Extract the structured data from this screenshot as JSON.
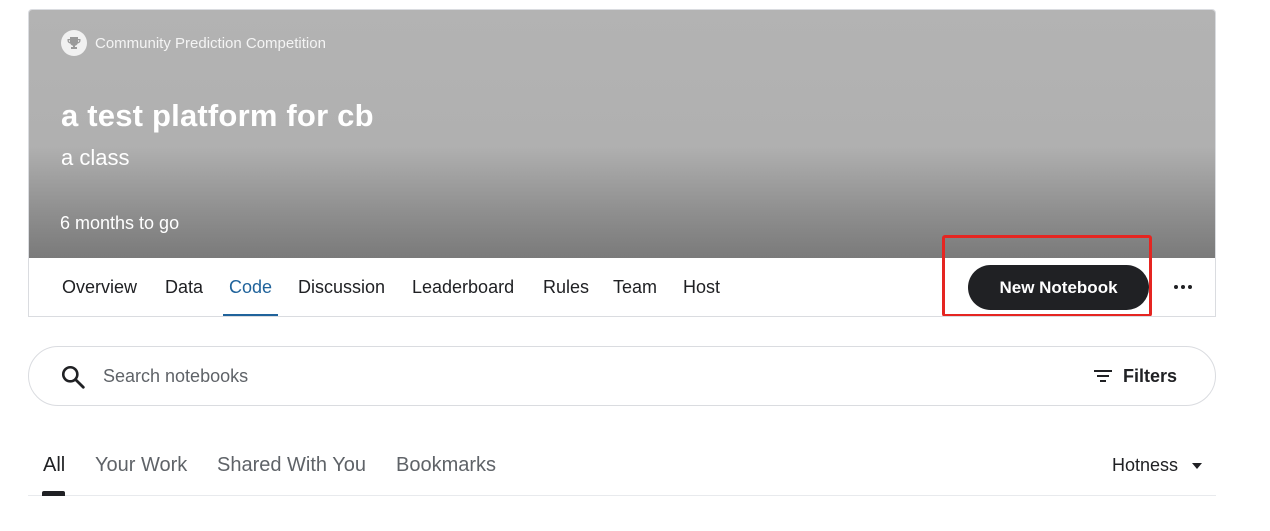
{
  "competition": {
    "type_label": "Community Prediction Competition",
    "title": "a test platform for cb",
    "subtitle": "a class",
    "deadline": "6 months to go"
  },
  "tabs": [
    {
      "label": "Overview"
    },
    {
      "label": "Data"
    },
    {
      "label": "Code",
      "active": true
    },
    {
      "label": "Discussion"
    },
    {
      "label": "Leaderboard"
    },
    {
      "label": "Rules"
    },
    {
      "label": "Team"
    },
    {
      "label": "Host"
    }
  ],
  "actions": {
    "new_notebook_label": "New Notebook",
    "more_icon": "more-horizontal-icon"
  },
  "search": {
    "placeholder": "Search notebooks",
    "value": "",
    "filters_label": "Filters"
  },
  "subtabs": [
    {
      "label": "All",
      "active": true
    },
    {
      "label": "Your Work"
    },
    {
      "label": "Shared With You"
    },
    {
      "label": "Bookmarks"
    }
  ],
  "sort": {
    "selected": "Hotness"
  },
  "colors": {
    "accent": "#20639b",
    "button_dark": "#202124",
    "highlight": "#e52521"
  }
}
